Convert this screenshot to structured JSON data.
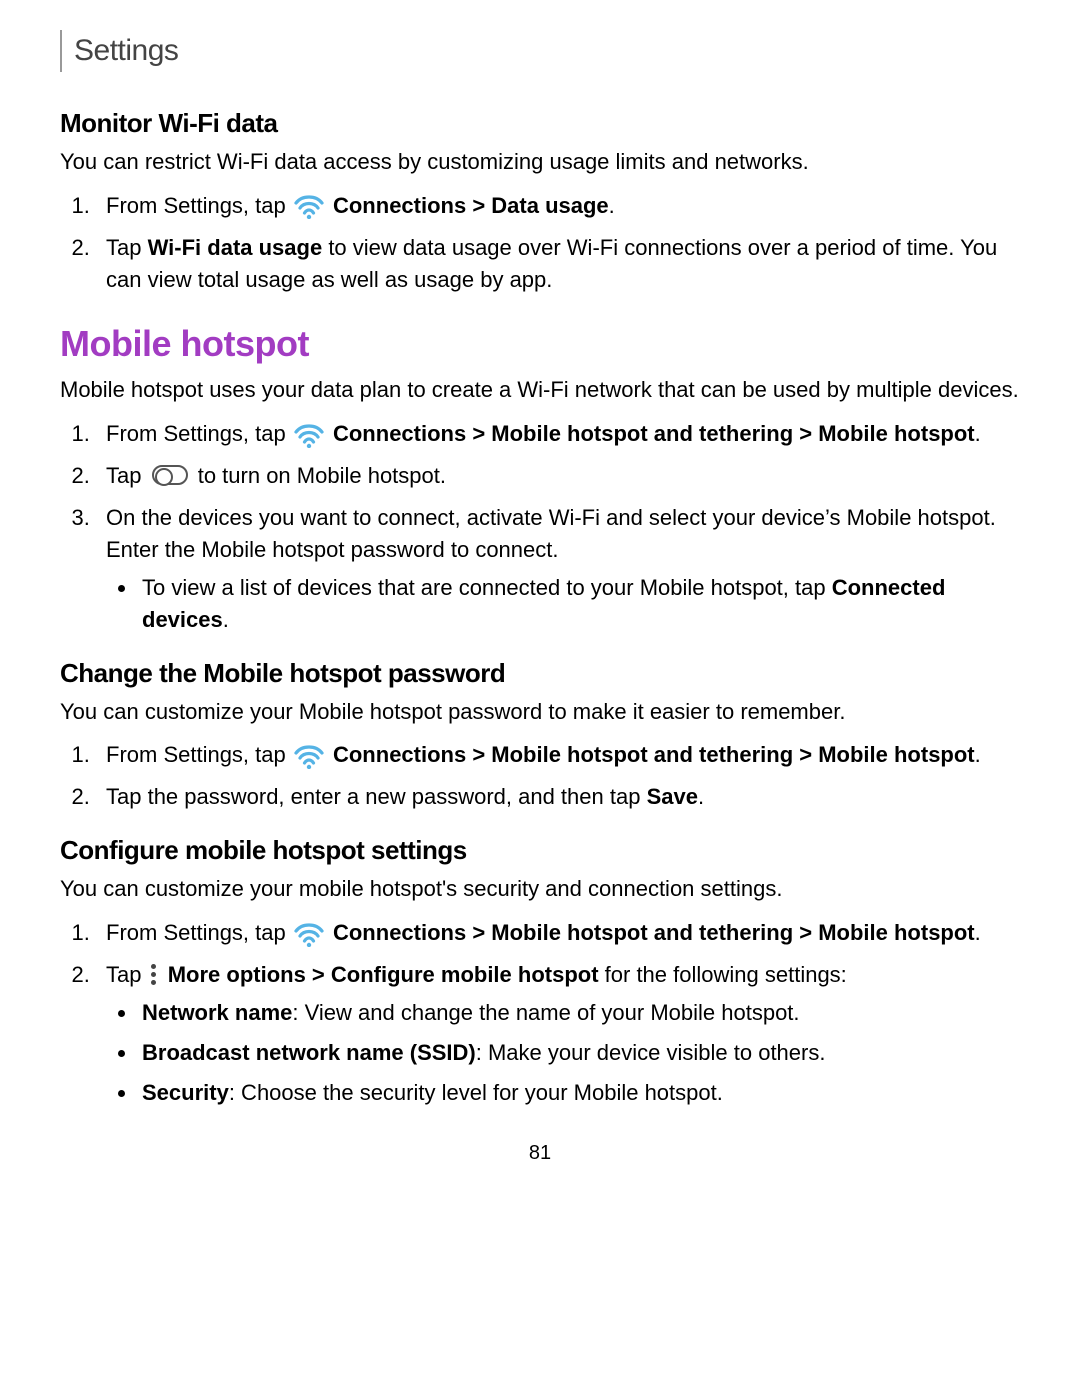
{
  "header": {
    "breadcrumb": "Settings"
  },
  "page_number": "81",
  "icons": {
    "wifi": "wifi-icon",
    "toggle": "toggle-off-icon",
    "more": "more-options-icon"
  },
  "section_monitor": {
    "title": "Monitor Wi-Fi data",
    "intro": "You can restrict Wi-Fi data access by customizing usage limits and networks.",
    "step1_pre": "From Settings, tap ",
    "step1_bold": "Connections > Data usage",
    "step2_pre": "Tap ",
    "step2_bold": "Wi-Fi data usage",
    "step2_post": " to view data usage over Wi-Fi connections over a period of time. You can view total usage as well as usage by app."
  },
  "section_hotspot": {
    "title": "Mobile hotspot",
    "intro": "Mobile hotspot uses your data plan to create a Wi-Fi network that can be used by multiple devices.",
    "step1_pre": "From Settings, tap ",
    "step1_bold": "Connections > Mobile hotspot and tethering > Mobile hotspot",
    "step2_pre": "Tap ",
    "step2_post": " to turn on Mobile hotspot.",
    "step3": "On the devices you want to connect, activate Wi-Fi and select your device’s Mobile hotspot. Enter the Mobile hotspot password to connect.",
    "bullet_pre": "To view a list of devices that are connected to your Mobile hotspot, tap ",
    "bullet_bold": "Connected devices"
  },
  "section_password": {
    "title": "Change the Mobile hotspot password",
    "intro": "You can customize your Mobile hotspot password to make it easier to remember.",
    "step1_pre": "From Settings, tap ",
    "step1_bold": "Connections > Mobile hotspot and tethering > Mobile hotspot",
    "step2_pre": "Tap the password, enter a new password, and then tap ",
    "step2_bold": "Save"
  },
  "section_configure": {
    "title": "Configure mobile hotspot settings",
    "intro": "You can customize your mobile hotspot's security and connection settings.",
    "step1_pre": "From Settings, tap ",
    "step1_bold": "Connections > Mobile hotspot and tethering > Mobile hotspot",
    "step2_pre": "Tap ",
    "step2_bold": "More options > Configure mobile hotspot",
    "step2_post": " for the following settings:",
    "bullets": {
      "b1_label": "Network name",
      "b1_text": ": View and change the name of your Mobile hotspot.",
      "b2_label": "Broadcast network name (SSID)",
      "b2_text": ": Make your device visible to others.",
      "b3_label": "Security",
      "b3_text": ": Choose the security level for your Mobile hotspot."
    }
  }
}
